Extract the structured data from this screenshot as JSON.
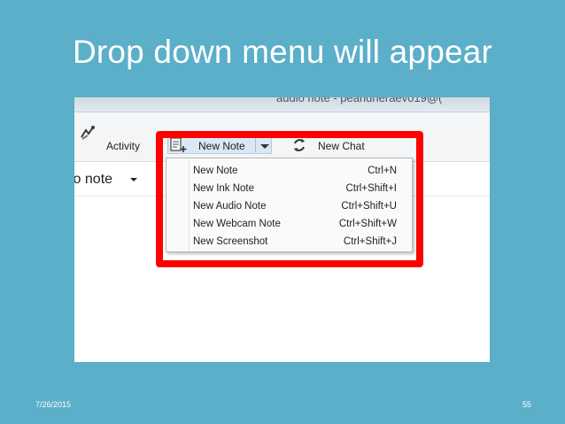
{
  "slide": {
    "title": "Drop down menu will appear",
    "date": "7/26/2015",
    "page_number": "55"
  },
  "window": {
    "title_fragment": "audio note - pearidheraev019@("
  },
  "ribbon": {
    "activity_label": "Activity",
    "new_note_label": "New Note",
    "new_chat_label": "New Chat"
  },
  "notebook": {
    "label": "io note"
  },
  "dropdown": {
    "items": [
      {
        "label": "New Note",
        "shortcut": "Ctrl+N"
      },
      {
        "label": "New Ink Note",
        "shortcut": "Ctrl+Shift+I"
      },
      {
        "label": "New Audio Note",
        "shortcut": "Ctrl+Shift+U"
      },
      {
        "label": "New Webcam Note",
        "shortcut": "Ctrl+Shift+W"
      },
      {
        "label": "New Screenshot",
        "shortcut": "Ctrl+Shift+J"
      }
    ]
  },
  "colors": {
    "slide_background": "#5bafc8",
    "highlight_border": "#ff0000",
    "button_active": "#dbe8f4"
  },
  "icons": [
    "activity-icon",
    "new-note-icon",
    "chevron-down-icon",
    "new-chat-icon"
  ]
}
